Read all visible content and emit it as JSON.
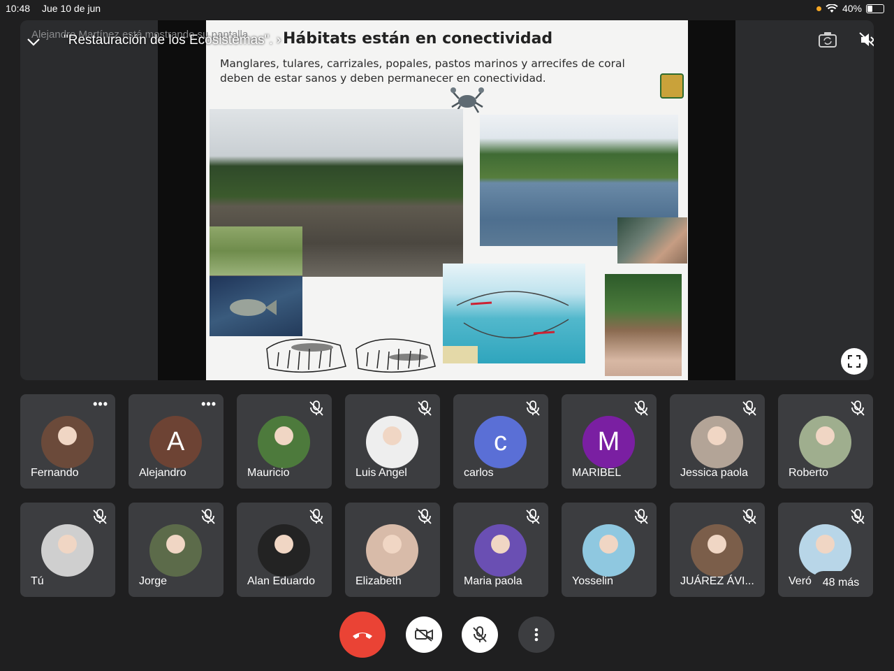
{
  "status": {
    "time": "10:48",
    "date": "Jue 10 de jun",
    "battery": "40%"
  },
  "meeting": {
    "presenting_text": "Alejandro Martínez está mostrando su pantalla",
    "title": "\"Restauración de los Ecosistemas\".",
    "title_chevron": "›"
  },
  "slide": {
    "title": "Hábitats están en conectividad",
    "body": "Manglares, tulares, carrizales, popales, pastos marinos y arrecifes de coral deben de estar sanos y deben permanecer en conectividad."
  },
  "participants": [
    {
      "name": "Fernando",
      "color": "#6b4a3a",
      "mic_off": false,
      "menu": true
    },
    {
      "name": "Alejandro",
      "initial": "A",
      "color": "#6d4334",
      "mic_off": false,
      "menu": true
    },
    {
      "name": "Mauricio",
      "color": "#4d7a3c",
      "mic_off": true
    },
    {
      "name": "Luis Angel",
      "color": "#eeeeee",
      "mic_off": true
    },
    {
      "name": "carlos",
      "initial": "c",
      "color": "#5a6fd6",
      "mic_off": true
    },
    {
      "name": "MARIBEL",
      "initial": "M",
      "color": "#7a1fa2",
      "mic_off": true
    },
    {
      "name": "Jessica paola",
      "color": "#b3a497",
      "mic_off": true
    },
    {
      "name": "Roberto",
      "color": "#9fae8e",
      "mic_off": true
    },
    {
      "name": "Tú",
      "color": "#cfcfcf",
      "mic_off": true
    },
    {
      "name": "Jorge",
      "color": "#5c6b4a",
      "mic_off": true
    },
    {
      "name": "Alan Eduardo",
      "color": "#232323",
      "mic_off": true
    },
    {
      "name": "Elizabeth",
      "color": "#d8bba9",
      "mic_off": true
    },
    {
      "name": "Maria paola",
      "color": "#6a4fb3",
      "mic_off": true
    },
    {
      "name": "Yosselin",
      "color": "#8fc8e0",
      "mic_off": true
    },
    {
      "name": "JUÁREZ ÁVI...",
      "color": "#7b5e4a",
      "mic_off": true
    },
    {
      "name": "Veró",
      "color": "#b8d6e8",
      "mic_off": true
    }
  ],
  "more_participants": "48 más",
  "colors": {
    "end_call": "#ea4335",
    "tile_bg": "#3c3d40",
    "page_bg": "#1f1f20"
  }
}
